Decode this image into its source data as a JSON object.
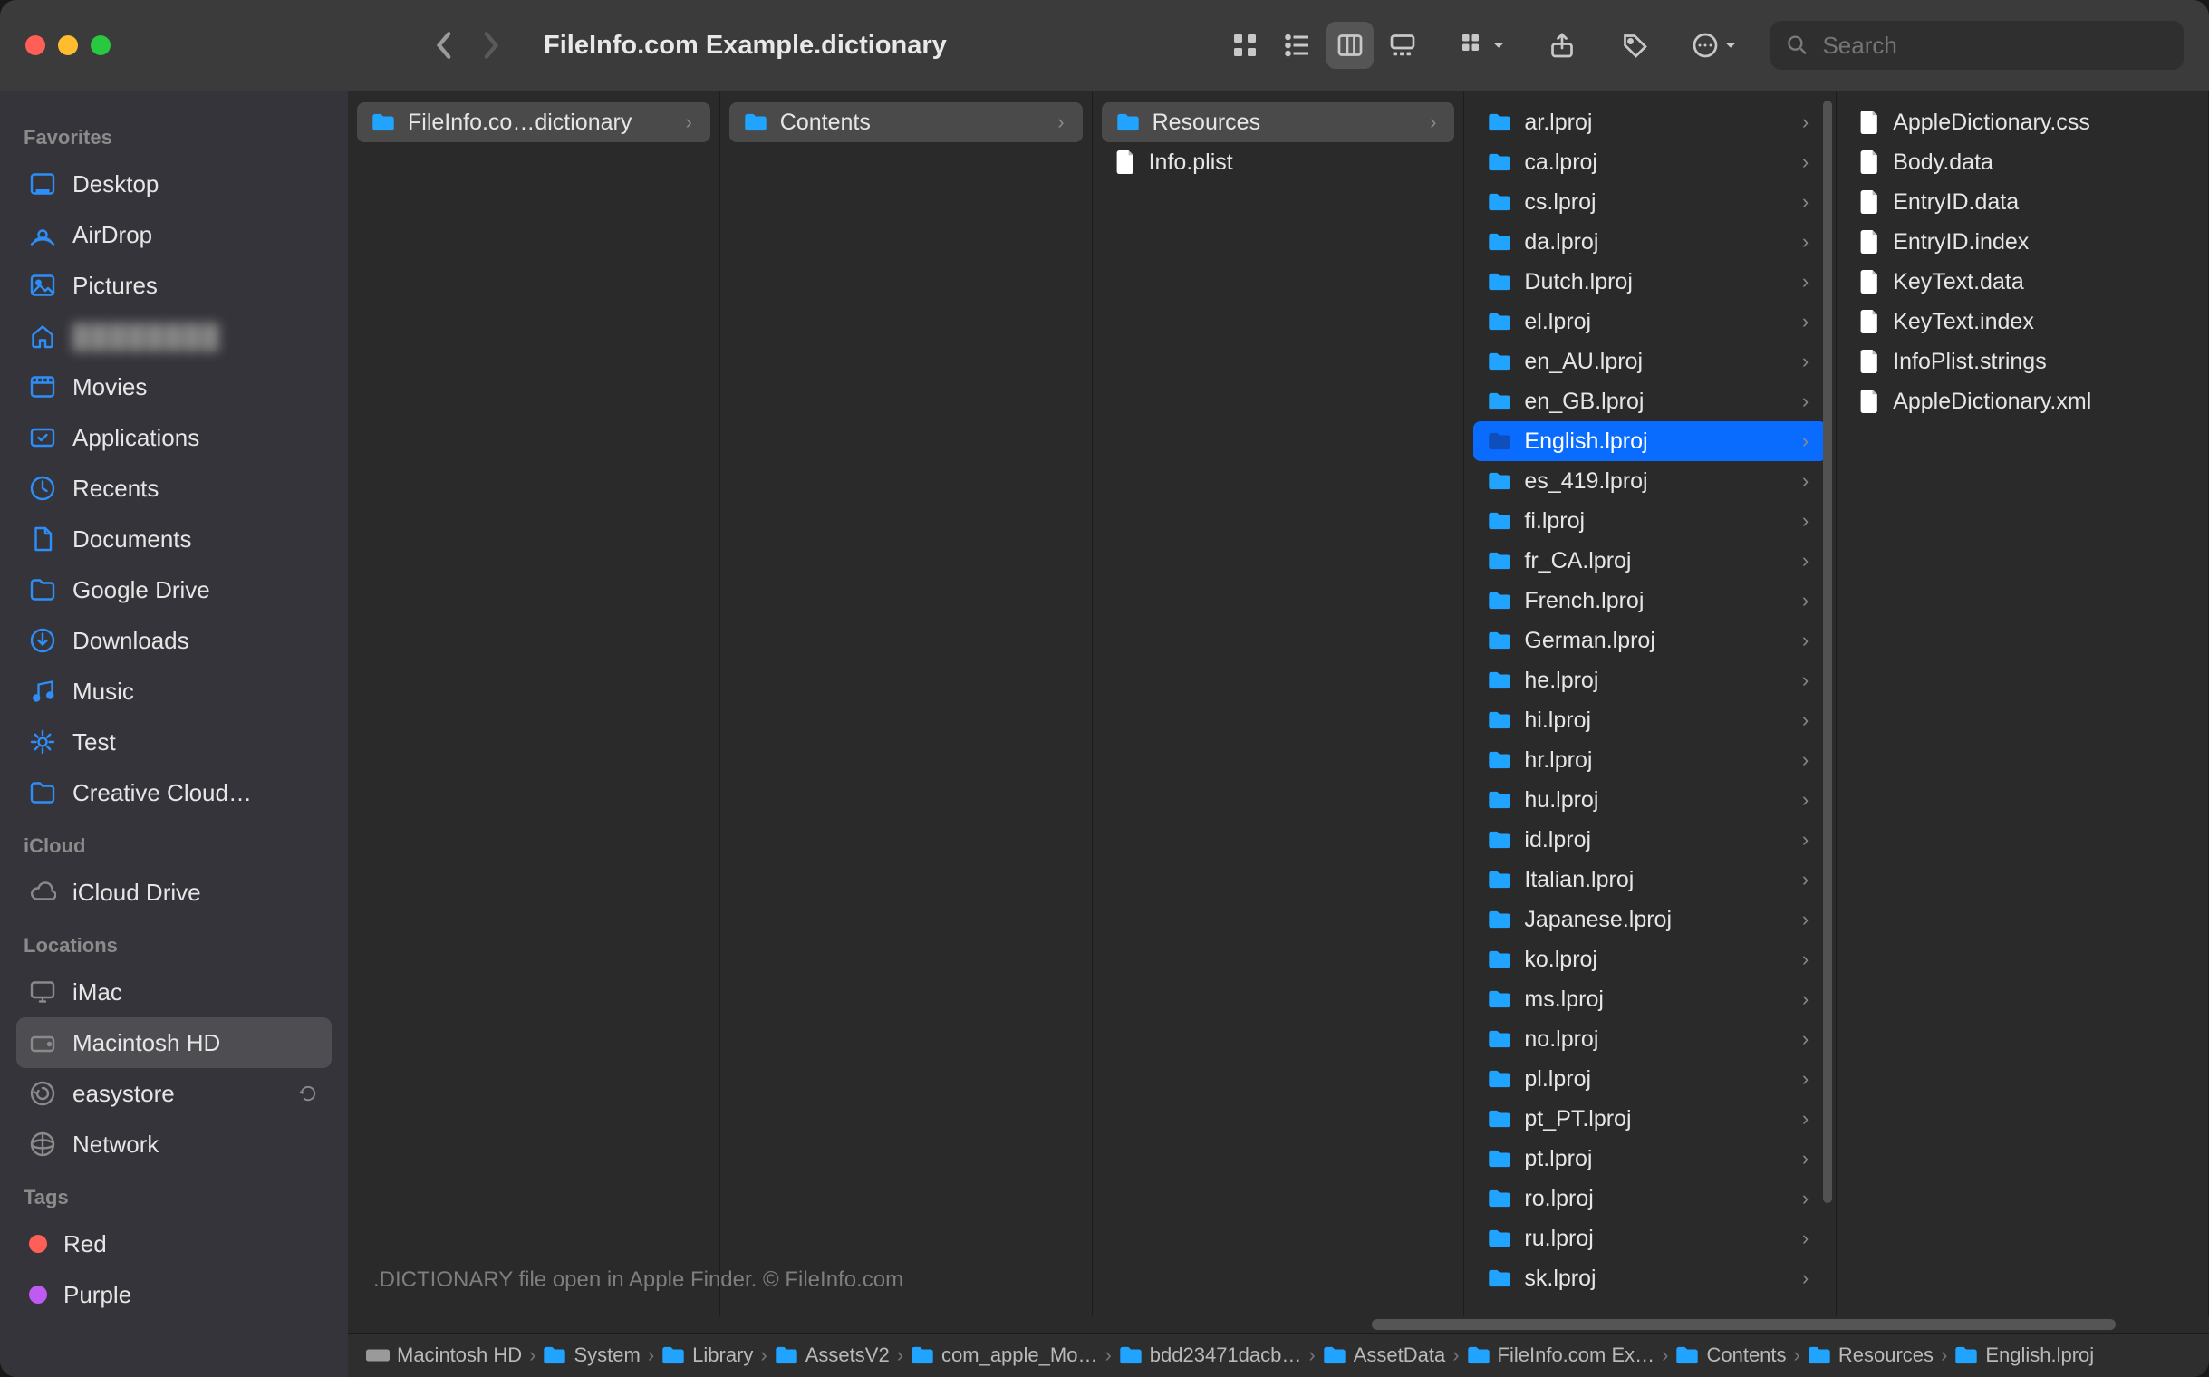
{
  "window": {
    "title": "FileInfo.com Example.dictionary"
  },
  "toolbar": {
    "search_placeholder": "Search"
  },
  "sidebar": {
    "sections": [
      {
        "title": "Favorites",
        "items": [
          {
            "icon": "desktop",
            "label": "Desktop"
          },
          {
            "icon": "airdrop",
            "label": "AirDrop"
          },
          {
            "icon": "pictures",
            "label": "Pictures"
          },
          {
            "icon": "home",
            "label": "",
            "blurred": true
          },
          {
            "icon": "movies",
            "label": "Movies"
          },
          {
            "icon": "apps",
            "label": "Applications"
          },
          {
            "icon": "recents",
            "label": "Recents"
          },
          {
            "icon": "documents",
            "label": "Documents"
          },
          {
            "icon": "folder",
            "label": "Google Drive"
          },
          {
            "icon": "downloads",
            "label": "Downloads"
          },
          {
            "icon": "music",
            "label": "Music"
          },
          {
            "icon": "gear",
            "label": "Test"
          },
          {
            "icon": "folder",
            "label": "Creative Cloud…"
          }
        ]
      },
      {
        "title": "iCloud",
        "items": [
          {
            "icon": "cloud",
            "label": "iCloud Drive",
            "grey": true
          }
        ]
      },
      {
        "title": "Locations",
        "items": [
          {
            "icon": "imac",
            "label": "iMac",
            "grey": true
          },
          {
            "icon": "hdd",
            "label": "Macintosh HD",
            "grey": true,
            "selected": true
          },
          {
            "icon": "time",
            "label": "easystore",
            "grey": true,
            "trailing": "refresh"
          }
        ]
      },
      {
        "title": "",
        "items": [
          {
            "icon": "network",
            "label": "Network",
            "grey": true
          }
        ]
      },
      {
        "title": "Tags",
        "items": [
          {
            "tagcolor": "#ff5f57",
            "label": "Red"
          },
          {
            "tagcolor": "#bf5af2",
            "label": "Purple"
          }
        ]
      }
    ]
  },
  "columns": [
    {
      "items": [
        {
          "type": "folder",
          "name": "FileInfo.co…dictionary",
          "active": true,
          "hasChildren": true
        }
      ]
    },
    {
      "items": [
        {
          "type": "folder",
          "name": "Contents",
          "active": true,
          "hasChildren": true
        }
      ]
    },
    {
      "items": [
        {
          "type": "folder",
          "name": "Resources",
          "active": true,
          "hasChildren": true
        },
        {
          "type": "file",
          "name": "Info.plist"
        }
      ]
    },
    {
      "scroll": true,
      "items": [
        {
          "type": "folder",
          "name": "ar.lproj",
          "hasChildren": true
        },
        {
          "type": "folder",
          "name": "ca.lproj",
          "hasChildren": true
        },
        {
          "type": "folder",
          "name": "cs.lproj",
          "hasChildren": true
        },
        {
          "type": "folder",
          "name": "da.lproj",
          "hasChildren": true
        },
        {
          "type": "folder",
          "name": "Dutch.lproj",
          "hasChildren": true
        },
        {
          "type": "folder",
          "name": "el.lproj",
          "hasChildren": true
        },
        {
          "type": "folder",
          "name": "en_AU.lproj",
          "hasChildren": true
        },
        {
          "type": "folder",
          "name": "en_GB.lproj",
          "hasChildren": true
        },
        {
          "type": "folder",
          "name": "English.lproj",
          "selected": true,
          "hasChildren": true
        },
        {
          "type": "folder",
          "name": "es_419.lproj",
          "hasChildren": true
        },
        {
          "type": "folder",
          "name": "fi.lproj",
          "hasChildren": true
        },
        {
          "type": "folder",
          "name": "fr_CA.lproj",
          "hasChildren": true
        },
        {
          "type": "folder",
          "name": "French.lproj",
          "hasChildren": true
        },
        {
          "type": "folder",
          "name": "German.lproj",
          "hasChildren": true
        },
        {
          "type": "folder",
          "name": "he.lproj",
          "hasChildren": true
        },
        {
          "type": "folder",
          "name": "hi.lproj",
          "hasChildren": true
        },
        {
          "type": "folder",
          "name": "hr.lproj",
          "hasChildren": true
        },
        {
          "type": "folder",
          "name": "hu.lproj",
          "hasChildren": true
        },
        {
          "type": "folder",
          "name": "id.lproj",
          "hasChildren": true
        },
        {
          "type": "folder",
          "name": "Italian.lproj",
          "hasChildren": true
        },
        {
          "type": "folder",
          "name": "Japanese.lproj",
          "hasChildren": true
        },
        {
          "type": "folder",
          "name": "ko.lproj",
          "hasChildren": true
        },
        {
          "type": "folder",
          "name": "ms.lproj",
          "hasChildren": true
        },
        {
          "type": "folder",
          "name": "no.lproj",
          "hasChildren": true
        },
        {
          "type": "folder",
          "name": "pl.lproj",
          "hasChildren": true
        },
        {
          "type": "folder",
          "name": "pt_PT.lproj",
          "hasChildren": true
        },
        {
          "type": "folder",
          "name": "pt.lproj",
          "hasChildren": true
        },
        {
          "type": "folder",
          "name": "ro.lproj",
          "hasChildren": true
        },
        {
          "type": "folder",
          "name": "ru.lproj",
          "hasChildren": true
        },
        {
          "type": "folder",
          "name": "sk.lproj",
          "hasChildren": true
        }
      ]
    },
    {
      "items": [
        {
          "type": "file",
          "name": "AppleDictionary.css"
        },
        {
          "type": "file",
          "name": "Body.data"
        },
        {
          "type": "file",
          "name": "EntryID.data"
        },
        {
          "type": "file",
          "name": "EntryID.index"
        },
        {
          "type": "file",
          "name": "KeyText.data"
        },
        {
          "type": "file",
          "name": "KeyText.index"
        },
        {
          "type": "file",
          "name": "InfoPlist.strings"
        },
        {
          "type": "file",
          "name": "AppleDictionary.xml"
        }
      ]
    }
  ],
  "caption": ".DICTIONARY file open in Apple Finder. © FileInfo.com",
  "path": [
    {
      "icon": "hdd",
      "label": "Macintosh HD"
    },
    {
      "icon": "folder",
      "label": "System"
    },
    {
      "icon": "folder",
      "label": "Library"
    },
    {
      "icon": "folder",
      "label": "AssetsV2"
    },
    {
      "icon": "folder",
      "label": "com_apple_Mo…"
    },
    {
      "icon": "folder",
      "label": "bdd23471dacb…"
    },
    {
      "icon": "folder",
      "label": "AssetData"
    },
    {
      "icon": "folder",
      "label": "FileInfo.com Ex…"
    },
    {
      "icon": "folder",
      "label": "Contents"
    },
    {
      "icon": "folder",
      "label": "Resources"
    },
    {
      "icon": "folder",
      "label": "English.lproj"
    }
  ]
}
